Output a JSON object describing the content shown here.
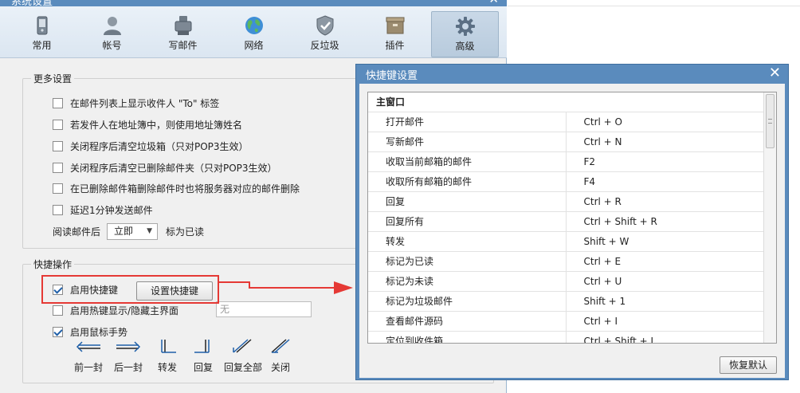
{
  "settings_window": {
    "title": "系统设置",
    "close_glyph": "✕",
    "tabs": [
      {
        "label": "常用",
        "icon": "phone-icon",
        "selected": false
      },
      {
        "label": "帐号",
        "icon": "person-icon",
        "selected": false
      },
      {
        "label": "写邮件",
        "icon": "mail-writer-icon",
        "selected": false
      },
      {
        "label": "网络",
        "icon": "globe-icon",
        "selected": false
      },
      {
        "label": "反垃圾",
        "icon": "shield-icon",
        "selected": false
      },
      {
        "label": "插件",
        "icon": "box-icon",
        "selected": false
      },
      {
        "label": "高级",
        "icon": "gear-icon",
        "selected": true
      }
    ],
    "more_settings": {
      "title": "更多设置",
      "options": [
        {
          "label": "在邮件列表上显示收件人 \"To\" 标签",
          "checked": false
        },
        {
          "label": "若发件人在地址簿中，则使用地址簿姓名",
          "checked": false
        },
        {
          "label": "关闭程序后清空垃圾箱（只对POP3生效）",
          "checked": false
        },
        {
          "label": "关闭程序后清空已删除邮件夹（只对POP3生效）",
          "checked": false
        },
        {
          "label": "在已删除邮件箱删除邮件时也将服务器对应的邮件删除",
          "checked": false
        },
        {
          "label": "延迟1分钟发送邮件",
          "checked": false
        }
      ],
      "read_mail_prefix": "阅读邮件后",
      "read_mail_select_value": "立即",
      "read_mail_suffix": "标为已读"
    },
    "shortcuts": {
      "title": "快捷操作",
      "enable_shortcut_label": "启用快捷键",
      "enable_shortcut_checked": true,
      "setup_shortcut_button": "设置快捷键",
      "hotkey_label": "启用热键显示/隐藏主界面",
      "hotkey_checked": false,
      "hotkey_input_value": "无",
      "mouse_gesture_label": "启用鼠标手势",
      "mouse_gesture_checked": true,
      "gestures": [
        "前一封",
        "后一封",
        "转发",
        "回复",
        "回复全部",
        "关闭"
      ]
    }
  },
  "shortcut_dialog": {
    "title": "快捷键设置",
    "close_glyph": "✕",
    "section": "主窗口",
    "rows": [
      {
        "action": "打开邮件",
        "keys": "Ctrl + O"
      },
      {
        "action": "写新邮件",
        "keys": "Ctrl + N"
      },
      {
        "action": "收取当前邮箱的邮件",
        "keys": "F2"
      },
      {
        "action": "收取所有邮箱的邮件",
        "keys": "F4"
      },
      {
        "action": "回复",
        "keys": "Ctrl + R"
      },
      {
        "action": "回复所有",
        "keys": "Ctrl + Shift + R"
      },
      {
        "action": "转发",
        "keys": "Shift + W"
      },
      {
        "action": "标记为已读",
        "keys": "Ctrl + E"
      },
      {
        "action": "标记为未读",
        "keys": "Ctrl + U"
      },
      {
        "action": "标记为垃圾邮件",
        "keys": "Shift + 1"
      },
      {
        "action": "查看邮件源码",
        "keys": "Ctrl + I"
      },
      {
        "action": "定位到收件箱",
        "keys": "Ctrl + Shift + I"
      }
    ],
    "restore_default_button": "恢复默认"
  },
  "colors": {
    "title_bar": "#5a8bbd",
    "annotation_red": "#e53935"
  }
}
